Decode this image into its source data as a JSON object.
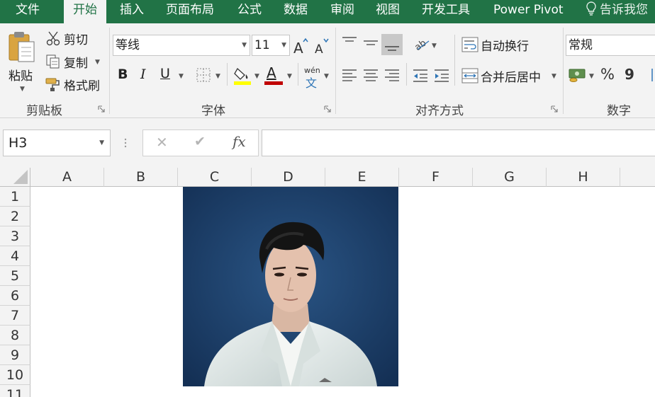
{
  "ribbon_tabs": [
    "文件",
    "开始",
    "插入",
    "页面布局",
    "公式",
    "数据",
    "审阅",
    "视图",
    "开发工具",
    "Power Pivot"
  ],
  "active_tab": "开始",
  "tell_me": "告诉我您",
  "clipboard": {
    "paste": "粘贴",
    "cut": "剪切",
    "copy": "复制",
    "format_painter": "格式刷",
    "label": "剪贴板"
  },
  "font": {
    "name": "等线",
    "size": "11",
    "bold": "B",
    "italic": "I",
    "underline": "U",
    "font_color_glyph": "A",
    "phonetic_top": "wén",
    "phonetic_bottom": "文",
    "label": "字体",
    "fill_color": "#ffff00",
    "text_color": "#c00000"
  },
  "alignment": {
    "wrap_text": "自动换行",
    "merge_center": "合并后居中",
    "label": "对齐方式"
  },
  "number": {
    "format": "常规",
    "percent": "%",
    "comma": "9",
    "label": "数字"
  },
  "formula_bar": {
    "name_box": "H3",
    "cancel": "✕",
    "enter": "✔",
    "function": "fx",
    "content": ""
  },
  "columns": [
    "A",
    "B",
    "C",
    "D",
    "E",
    "F",
    "G",
    "H"
  ],
  "rows": [
    "1",
    "2",
    "3",
    "4",
    "5",
    "6",
    "7",
    "8",
    "9",
    "10",
    "11"
  ],
  "colors": {
    "brand": "#217346",
    "photo_background": "#1d3f66"
  }
}
